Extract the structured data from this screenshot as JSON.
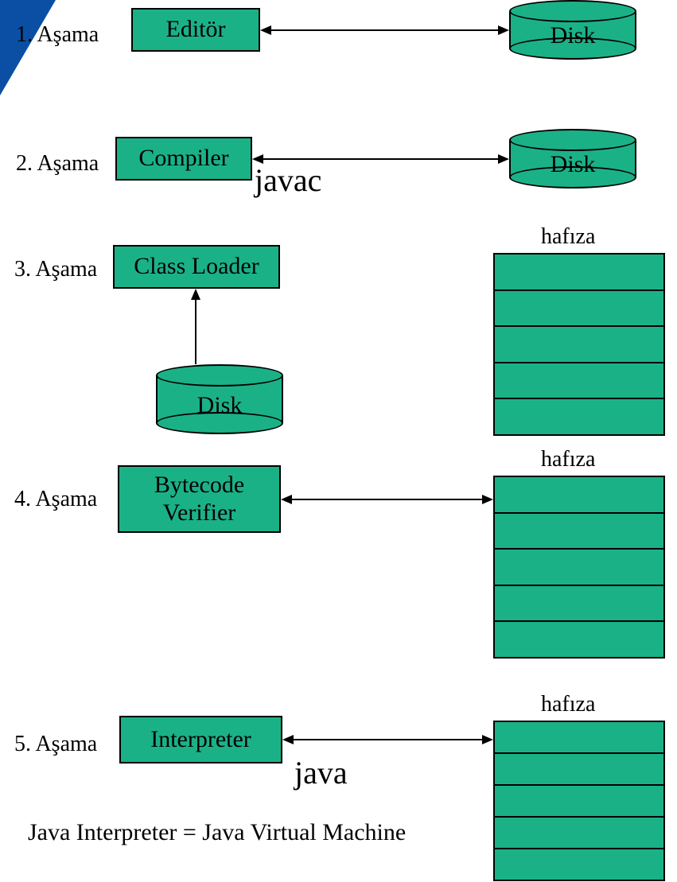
{
  "stages": {
    "s1": "1. Aşama",
    "s2": "2. Aşama",
    "s3": "3. Aşama",
    "s4": "4. Aşama",
    "s5": "5. Aşama"
  },
  "boxes": {
    "editor": "Editör",
    "compiler": "Compiler",
    "classloader": "Class Loader",
    "verifier_line1": "Bytecode",
    "verifier_line2": "Verifier",
    "interpreter": "Interpreter"
  },
  "disks": {
    "d1": "Disk",
    "d2": "Disk",
    "d3": "Disk"
  },
  "memory_label": "hafıza",
  "annotations": {
    "javac": "javac",
    "java": "java"
  },
  "footer": "Java Interpreter = Java Virtual Machine",
  "colors": {
    "fill": "#1bb187",
    "corner": "#0a4fa3"
  }
}
